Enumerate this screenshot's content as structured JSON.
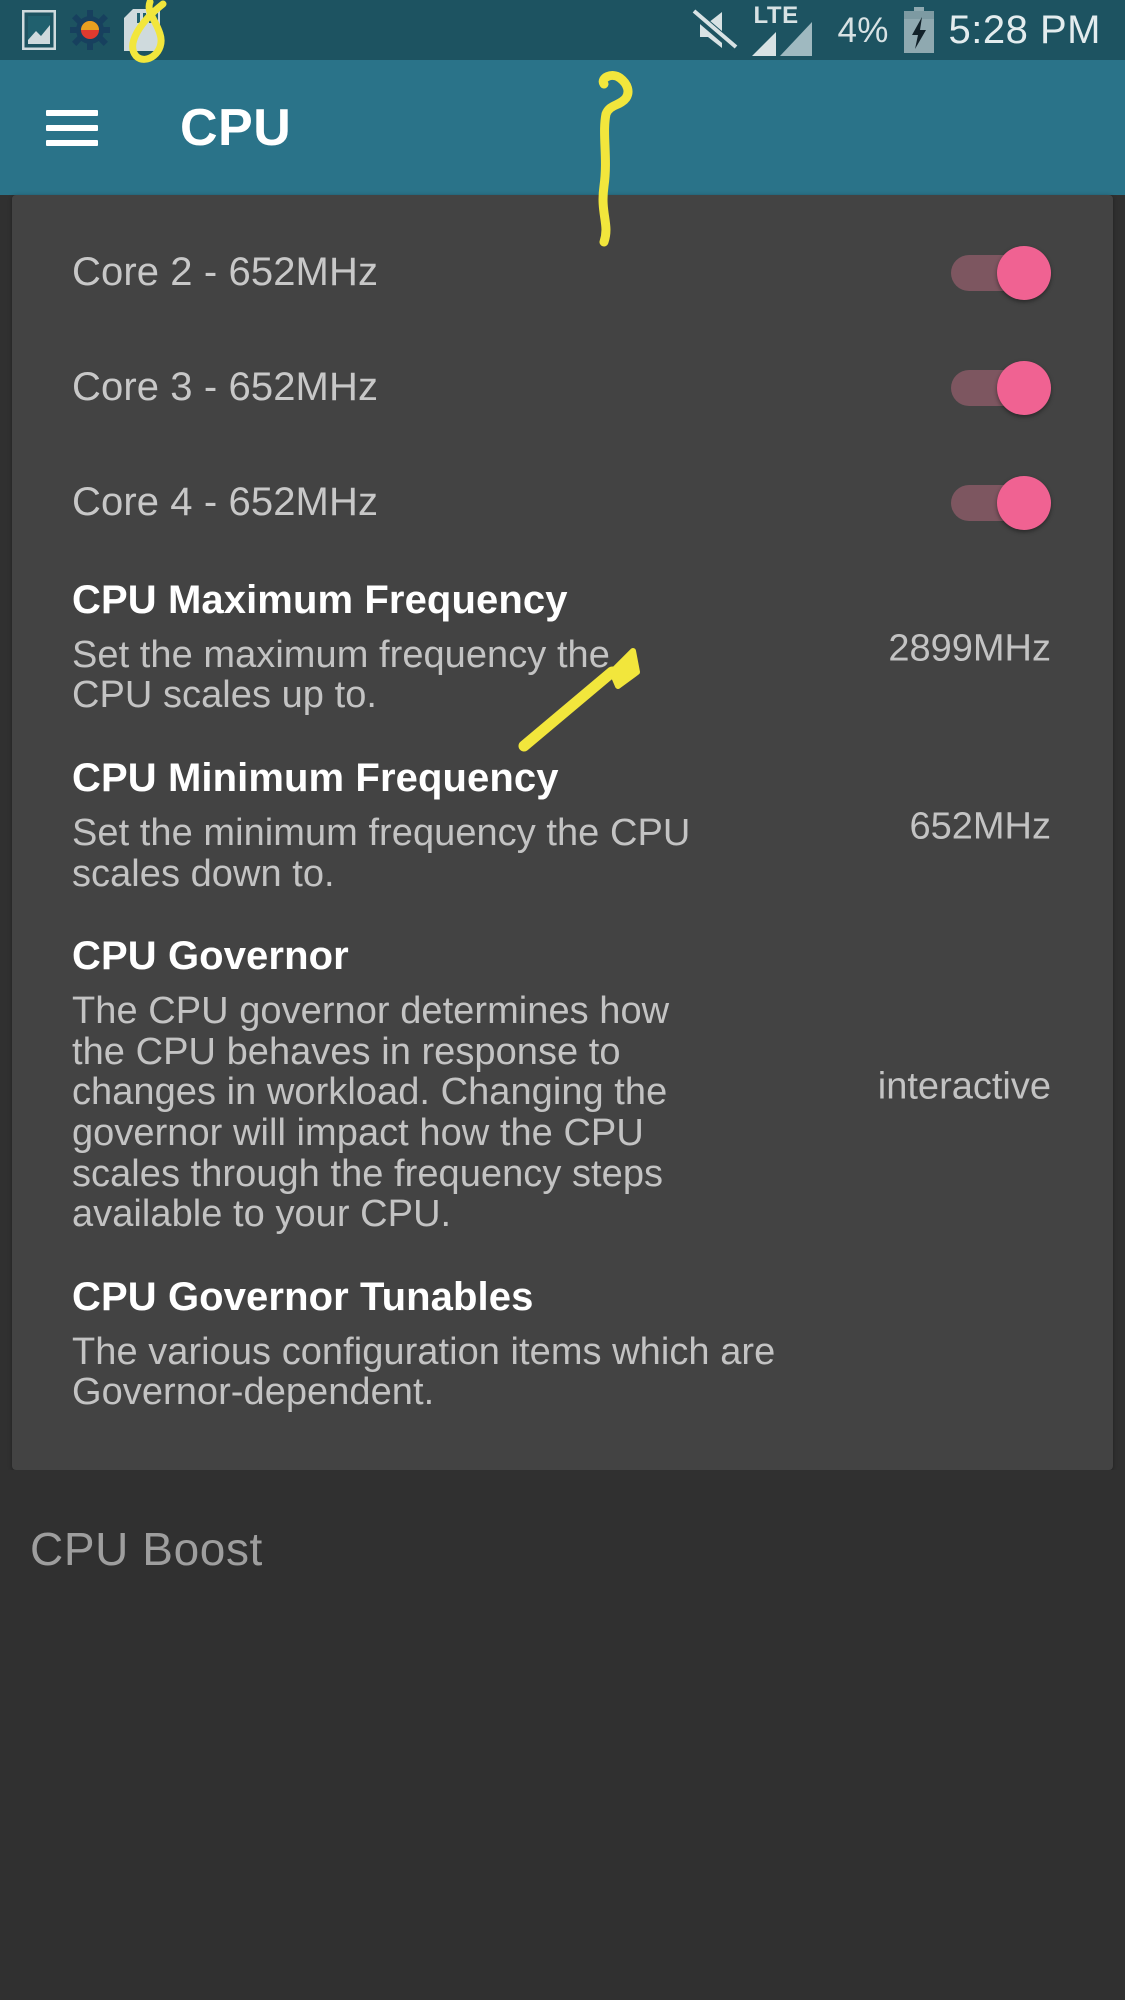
{
  "statusbar": {
    "icons_left": [
      "screenshot-image-icon",
      "settings-gear-icon",
      "sd-card-icon"
    ],
    "mute_icon": "volume-mute-icon",
    "network_label": "LTE",
    "signal_icon": "signal-bars-icon",
    "battery_percent": "4%",
    "battery_icon": "battery-charging-icon",
    "clock": "5:28 PM"
  },
  "appbar": {
    "menu_icon": "hamburger-menu-icon",
    "title": "CPU"
  },
  "cores": [
    {
      "label": "Core 2 - 652MHz",
      "enabled": true
    },
    {
      "label": "Core 3 - 652MHz",
      "enabled": true
    },
    {
      "label": "Core 4 - 652MHz",
      "enabled": true
    }
  ],
  "settings": [
    {
      "title": "CPU Maximum Frequency",
      "description": "Set the maximum frequency the CPU scales up to.",
      "value": "2899MHz"
    },
    {
      "title": "CPU Minimum Frequency",
      "description": "Set the minimum frequency the CPU scales down to.",
      "value": "652MHz"
    },
    {
      "title": "CPU Governor",
      "description": "The CPU governor determines how the CPU behaves in response to changes in workload. Changing the governor will impact how the CPU scales through the frequency steps available to your CPU.",
      "value": "interactive"
    },
    {
      "title": "CPU Governor Tunables",
      "description": "The various configuration items which are Governor-dependent.",
      "value": ""
    }
  ],
  "bottom": {
    "section_header": "CPU Boost"
  },
  "colors": {
    "statusbar_bg": "#1d5361",
    "appbar_bg": "#2a7389",
    "card_bg": "#434343",
    "page_bg": "#303030",
    "toggle_thumb": "#f06292",
    "toggle_track": "#7d5660",
    "annotation": "#f2e63c",
    "primary_text": "#ffffff",
    "secondary_text": "#c3c3c3"
  }
}
